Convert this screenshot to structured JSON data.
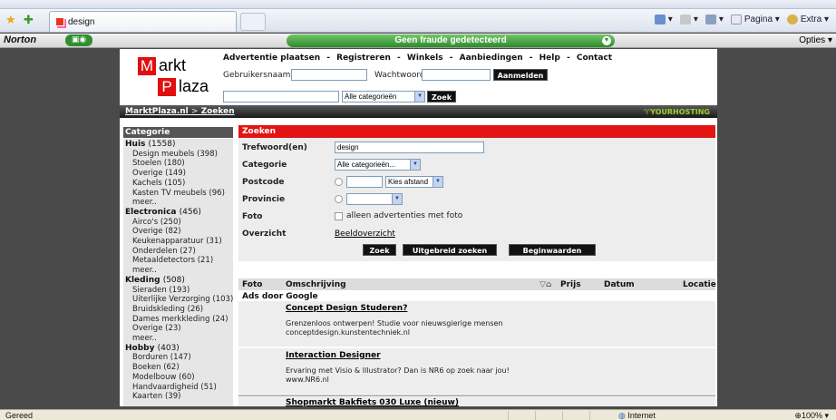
{
  "browser": {
    "tab_title": "design",
    "commands": {
      "home": "",
      "feeds": "",
      "print": "",
      "page": "Pagina",
      "extra": "Extra"
    }
  },
  "norton": {
    "logo": "Norton",
    "status": "Geen fraude gedetecteerd",
    "options": "Opties"
  },
  "site": {
    "logo": {
      "m": "M",
      "arkt": "arkt",
      "p": "P",
      "laza": "laza"
    },
    "nav": [
      "Advertentie plaatsen",
      "-",
      "Registreren",
      "-",
      "Winkels",
      "-",
      "Aanbiedingen",
      "-",
      "Help",
      "-",
      "Contact"
    ],
    "login": {
      "user_label": "Gebruikersnaam:",
      "pass_label": "Wachtwoord:",
      "submit": "Aanmelden"
    },
    "quicksearch": {
      "value": "",
      "category": "Alle categorieën",
      "button": "Zoek"
    },
    "breadcrumb": {
      "home": "MarktPlaza.nl",
      "sep": ">",
      "current": "Zoeken"
    },
    "hosting": "YOURHOSTING"
  },
  "sidebar": {
    "title": "Categorie",
    "groups": [
      {
        "name": "Huis",
        "count": "(1558)",
        "items": [
          "Design meubels (398)",
          "Stoelen (180)",
          "Overige (149)",
          "Kachels (105)",
          "Kasten TV meubels (96)",
          "meer.."
        ]
      },
      {
        "name": "Electronica",
        "count": "(456)",
        "items": [
          "Airco's (250)",
          "Overige (82)",
          "Keukenapparatuur (31)",
          "Onderdelen (27)",
          "Metaaldetectors (21)",
          "meer.."
        ]
      },
      {
        "name": "Kleding",
        "count": "(508)",
        "items": [
          "Sieraden (193)",
          "Uiterlijke Verzorging (103)",
          "Bruidskleding (26)",
          "Dames merkkleding (24)",
          "Overige (23)",
          "meer.."
        ]
      },
      {
        "name": "Hobby",
        "count": "(403)",
        "items": [
          "Borduren (147)",
          "Boeken (62)",
          "Modelbouw (60)",
          "Handvaardigheid (51)",
          "Kaarten (39)"
        ]
      }
    ]
  },
  "search": {
    "title": "Zoeken",
    "trefwoord_label": "Trefwoord(en)",
    "trefwoord_value": "design",
    "categorie_label": "Categorie",
    "categorie_value": "Alle categorieën...",
    "postcode_label": "Postcode",
    "afstand_value": "Kies afstand",
    "provincie_label": "Provincie",
    "foto_label": "Foto",
    "foto_checkbox": "alleen advertenties met foto",
    "overzicht_label": "Overzicht",
    "overzicht_link": "Beeldoverzicht",
    "buttons": {
      "zoek": "Zoek",
      "uitgebreid": "Uitgebreid zoeken",
      "begin": "Beginwaarden"
    }
  },
  "results": {
    "columns": {
      "foto": "Foto",
      "omschrijving": "Omschrijving",
      "prijs": "Prijs",
      "datum": "Datum",
      "locatie": "Locatie"
    },
    "ads_label": "Ads door Google",
    "ads": [
      {
        "title": "Concept Design Studeren?",
        "line1": "Grenzenloos ontwerpen! Studie voor nieuwsgierige mensen",
        "line2": "conceptdesign.kunstentechniek.nl"
      },
      {
        "title": "Interaction Designer",
        "line1": "Ervaring met Visio & Illustrator? Dan is NR6 op zoek naar jou!",
        "line2": "www.NR6.nl"
      }
    ],
    "first_listing": "Shopmarkt Bakfiets 030 Luxe (nieuw)"
  },
  "statusbar": {
    "text": "Gereed",
    "zone": "Internet",
    "zoom": "100%"
  }
}
